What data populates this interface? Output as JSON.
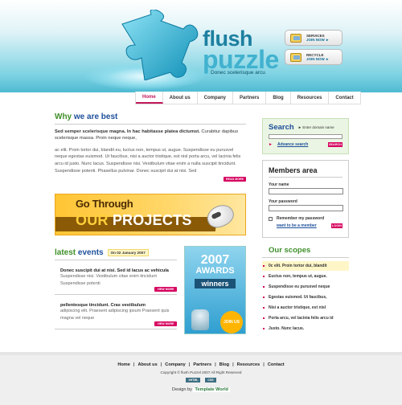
{
  "header": {
    "logo_line1": "flush",
    "logo_line2": "puzzle",
    "tagline": "Donec scelerisque arcu",
    "buttons": [
      {
        "title": "SERVICES",
        "action": "JOIN NOW ►"
      },
      {
        "title": "RECYCLE",
        "action": "JOIN NOW ►"
      }
    ]
  },
  "nav": [
    "Home",
    "About us",
    "Company",
    "Partners",
    "Blog",
    "Resources",
    "Contact"
  ],
  "why": {
    "title_a": "Why",
    "title_b": "we are best",
    "lead_bold": "Sed semper scelerisque magna. In hac habitasse platea dictumst.",
    "lead_rest": " Curabitur dapibus scelerisque massa. Proin neque neque,",
    "body": "ac elit. Proin tortor dui, blandit eu, luctus non, tempus ut, augue. Suspendisse eu purusvel neque egestas euismod. Ut faucibus, nisi a auctor tristique, est nisl porta arcu, vel lacinia felis arcu id justo. Nunc lacus. Suspendisse nisi. Vestibulum vitae enim a nulla suscipit tincidunt. Suspendisse potenti. Phasellus pulvinar. Donec suscipit dui at nisi. Sed",
    "more": "READ MORE"
  },
  "banner": {
    "line1": "Go Through",
    "line2a": "OUR",
    "line2b": "PROJECTS"
  },
  "events": {
    "title_a": "latest",
    "title_b": "events",
    "date": "On 02 January 2007",
    "items": [
      {
        "title": "Donec suscipit dui at nisi. Sed id lacus ac vehicula",
        "text": "Suspendisse nisi. Vestibulum vitae enim tincidunt Suspendisse potenti",
        "more": "VIEW MORE"
      },
      {
        "title": "pellentesque tincidunt. Cras vestibulum",
        "text": "adipiscing elit. Praesent adipiscing ipsum Praesent quis magna vel neque",
        "more": "VIEW MORE"
      }
    ]
  },
  "awards": {
    "year": "2007",
    "label": "AWARDS",
    "winners": "winners",
    "badge": "JOIN US"
  },
  "search": {
    "title": "Search",
    "hint": "► Enter domain name",
    "advanced": "Advance search",
    "button": "SEARCH"
  },
  "members": {
    "title": "Members area",
    "name_label": "Your name",
    "password_label": "Your password",
    "remember": "Remember my password",
    "want": "want to be a member",
    "login": "LOGIN"
  },
  "scopes": {
    "title": "Our scopes",
    "items": [
      "0c elit. Proin tortor dui, blandit",
      "Euctus non, tempus ut, augue.",
      "Suspendisse eu purusvel neque",
      "Egestas euismod. Ut faucibus,",
      "Nisi a auctor tristique, est nisl",
      "Porta arcu, vel lacinia felis arcu id",
      "Justo. Nunc lacus."
    ]
  },
  "footer": {
    "links": [
      "Home",
      "About us",
      "Company",
      "Partners",
      "Blog",
      "Resources",
      "Contact"
    ],
    "copyright": "Copyright © flush Puzzel 2007 All Right Reserved",
    "badges": [
      "XHTML",
      "CSS"
    ],
    "design_by": "Design by",
    "designer": "Template World"
  },
  "colors": {
    "accent": "#d6005f",
    "heading_blue": "#1d4f9a",
    "heading_green": "#3f8f2a",
    "header_teal": "#4fbad2"
  }
}
